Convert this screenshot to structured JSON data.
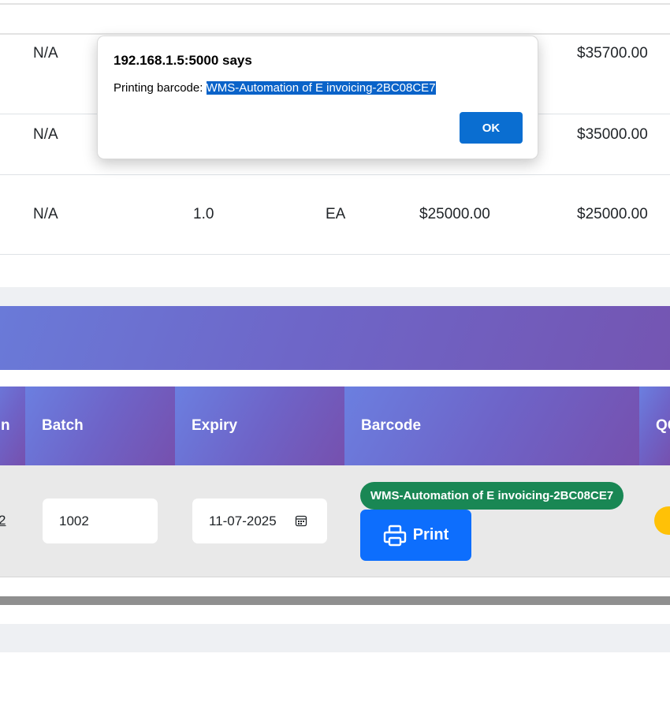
{
  "top_table": {
    "rows": [
      {
        "col1": "N/A",
        "qty": "",
        "uom": "",
        "price": "",
        "total": "$35700.00"
      },
      {
        "col1": "N/A",
        "qty": "",
        "uom": "",
        "price": "",
        "total": "$35000.00"
      },
      {
        "col1": "N/A",
        "qty": "1.0",
        "uom": "EA",
        "price": "$25000.00",
        "total": "$25000.00"
      }
    ]
  },
  "lower_table": {
    "headers": {
      "partial": "n",
      "batch": "Batch",
      "expiry": "Expiry",
      "barcode": "Barcode",
      "qc": "QC"
    },
    "row": {
      "partial_value": "2",
      "batch_value": "1002",
      "expiry_value": "11-07-2025",
      "barcode_value": "WMS-Automation of E invoicing-2BC08CE7",
      "print_label": "Print"
    }
  },
  "dialog": {
    "title": "192.168.1.5:5000 says",
    "message_prefix": "Printing barcode: ",
    "message_selected": "WMS-Automation of E invoicing-2BC08CE7",
    "ok_label": "OK"
  },
  "colors": {
    "header_gradient_start": "#6b7fe0",
    "header_gradient_end": "#7650ae",
    "barcode_pill": "#198754",
    "print_button": "#0d6efd",
    "qc_status": "#ffc107",
    "ok_button": "#0a6ed1"
  },
  "icons": {
    "printer": "printer-icon",
    "calendar": "calendar-icon"
  }
}
